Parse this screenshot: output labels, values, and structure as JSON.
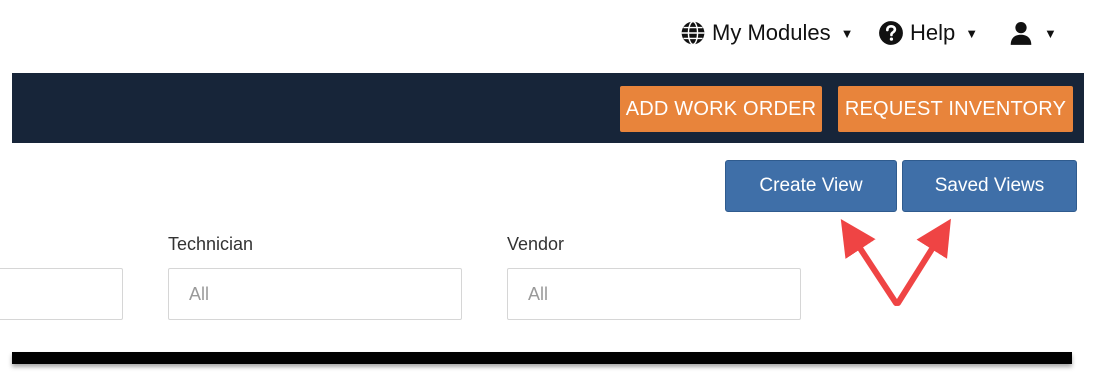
{
  "topnav": {
    "modules_label": "My Modules",
    "help_label": "Help"
  },
  "toolbar": {
    "add_work_order_label": "ADD WORK ORDER",
    "request_inventory_label": "REQUEST INVENTORY"
  },
  "views": {
    "create_view_label": "Create View",
    "saved_views_label": "Saved Views"
  },
  "filters": {
    "technician": {
      "label": "Technician",
      "placeholder": "All"
    },
    "vendor": {
      "label": "Vendor",
      "placeholder": "All"
    }
  },
  "colors": {
    "navy": "#172539",
    "orange": "#e8843b",
    "blue": "#3f6fa8",
    "annotation_red": "#ef4444"
  },
  "icons": {
    "modules": "globe-icon",
    "help": "question-circle-icon",
    "user": "user-icon",
    "caret": "caret-down-icon"
  }
}
